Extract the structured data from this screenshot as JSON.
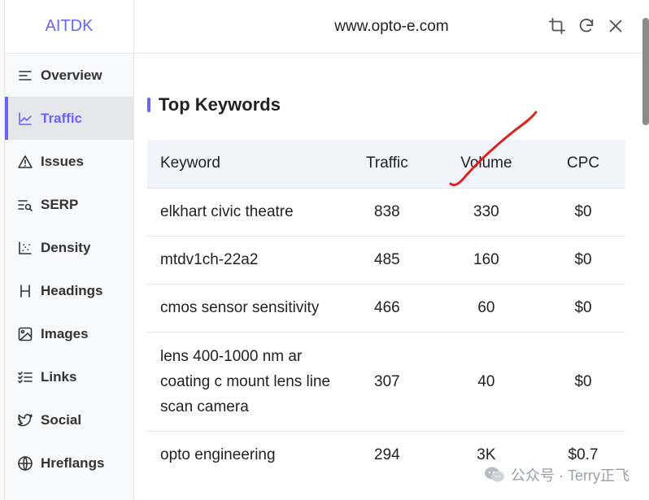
{
  "brand": {
    "name": "AITDK"
  },
  "header": {
    "site": "www.opto-e.com"
  },
  "sidebar": {
    "items": [
      {
        "label": "Overview",
        "icon": "overview-icon",
        "active": false
      },
      {
        "label": "Traffic",
        "icon": "traffic-chart-icon",
        "active": true
      },
      {
        "label": "Issues",
        "icon": "warning-icon",
        "active": false
      },
      {
        "label": "SERP",
        "icon": "serp-search-icon",
        "active": false
      },
      {
        "label": "Density",
        "icon": "density-scatter-icon",
        "active": false
      },
      {
        "label": "Headings",
        "icon": "heading-h-icon",
        "active": false
      },
      {
        "label": "Images",
        "icon": "image-icon",
        "active": false
      },
      {
        "label": "Links",
        "icon": "list-links-icon",
        "active": false
      },
      {
        "label": "Social",
        "icon": "twitter-bird-icon",
        "active": false
      },
      {
        "label": "Hreflangs",
        "icon": "globe-icon",
        "active": false
      }
    ]
  },
  "main": {
    "section_title": "Top Keywords",
    "columns": [
      "Keyword",
      "Traffic",
      "Volume",
      "CPC"
    ],
    "rows": [
      {
        "keyword": "elkhart civic theatre",
        "traffic": "838",
        "volume": "330",
        "cpc": "$0"
      },
      {
        "keyword": "mtdv1ch-22a2",
        "traffic": "485",
        "volume": "160",
        "cpc": "$0"
      },
      {
        "keyword": "cmos sensor sensitivity",
        "traffic": "466",
        "volume": "60",
        "cpc": "$0"
      },
      {
        "keyword": "lens 400-1000 nm ar coating c mount lens line scan camera",
        "traffic": "307",
        "volume": "40",
        "cpc": "$0"
      },
      {
        "keyword": "opto engineering",
        "traffic": "294",
        "volume": "3K",
        "cpc": "$0.7"
      }
    ]
  },
  "watermark": {
    "text": "公众号 · Terry正飞"
  },
  "colors": {
    "accent": "#6c63ff",
    "annotation": "#e0201a"
  }
}
